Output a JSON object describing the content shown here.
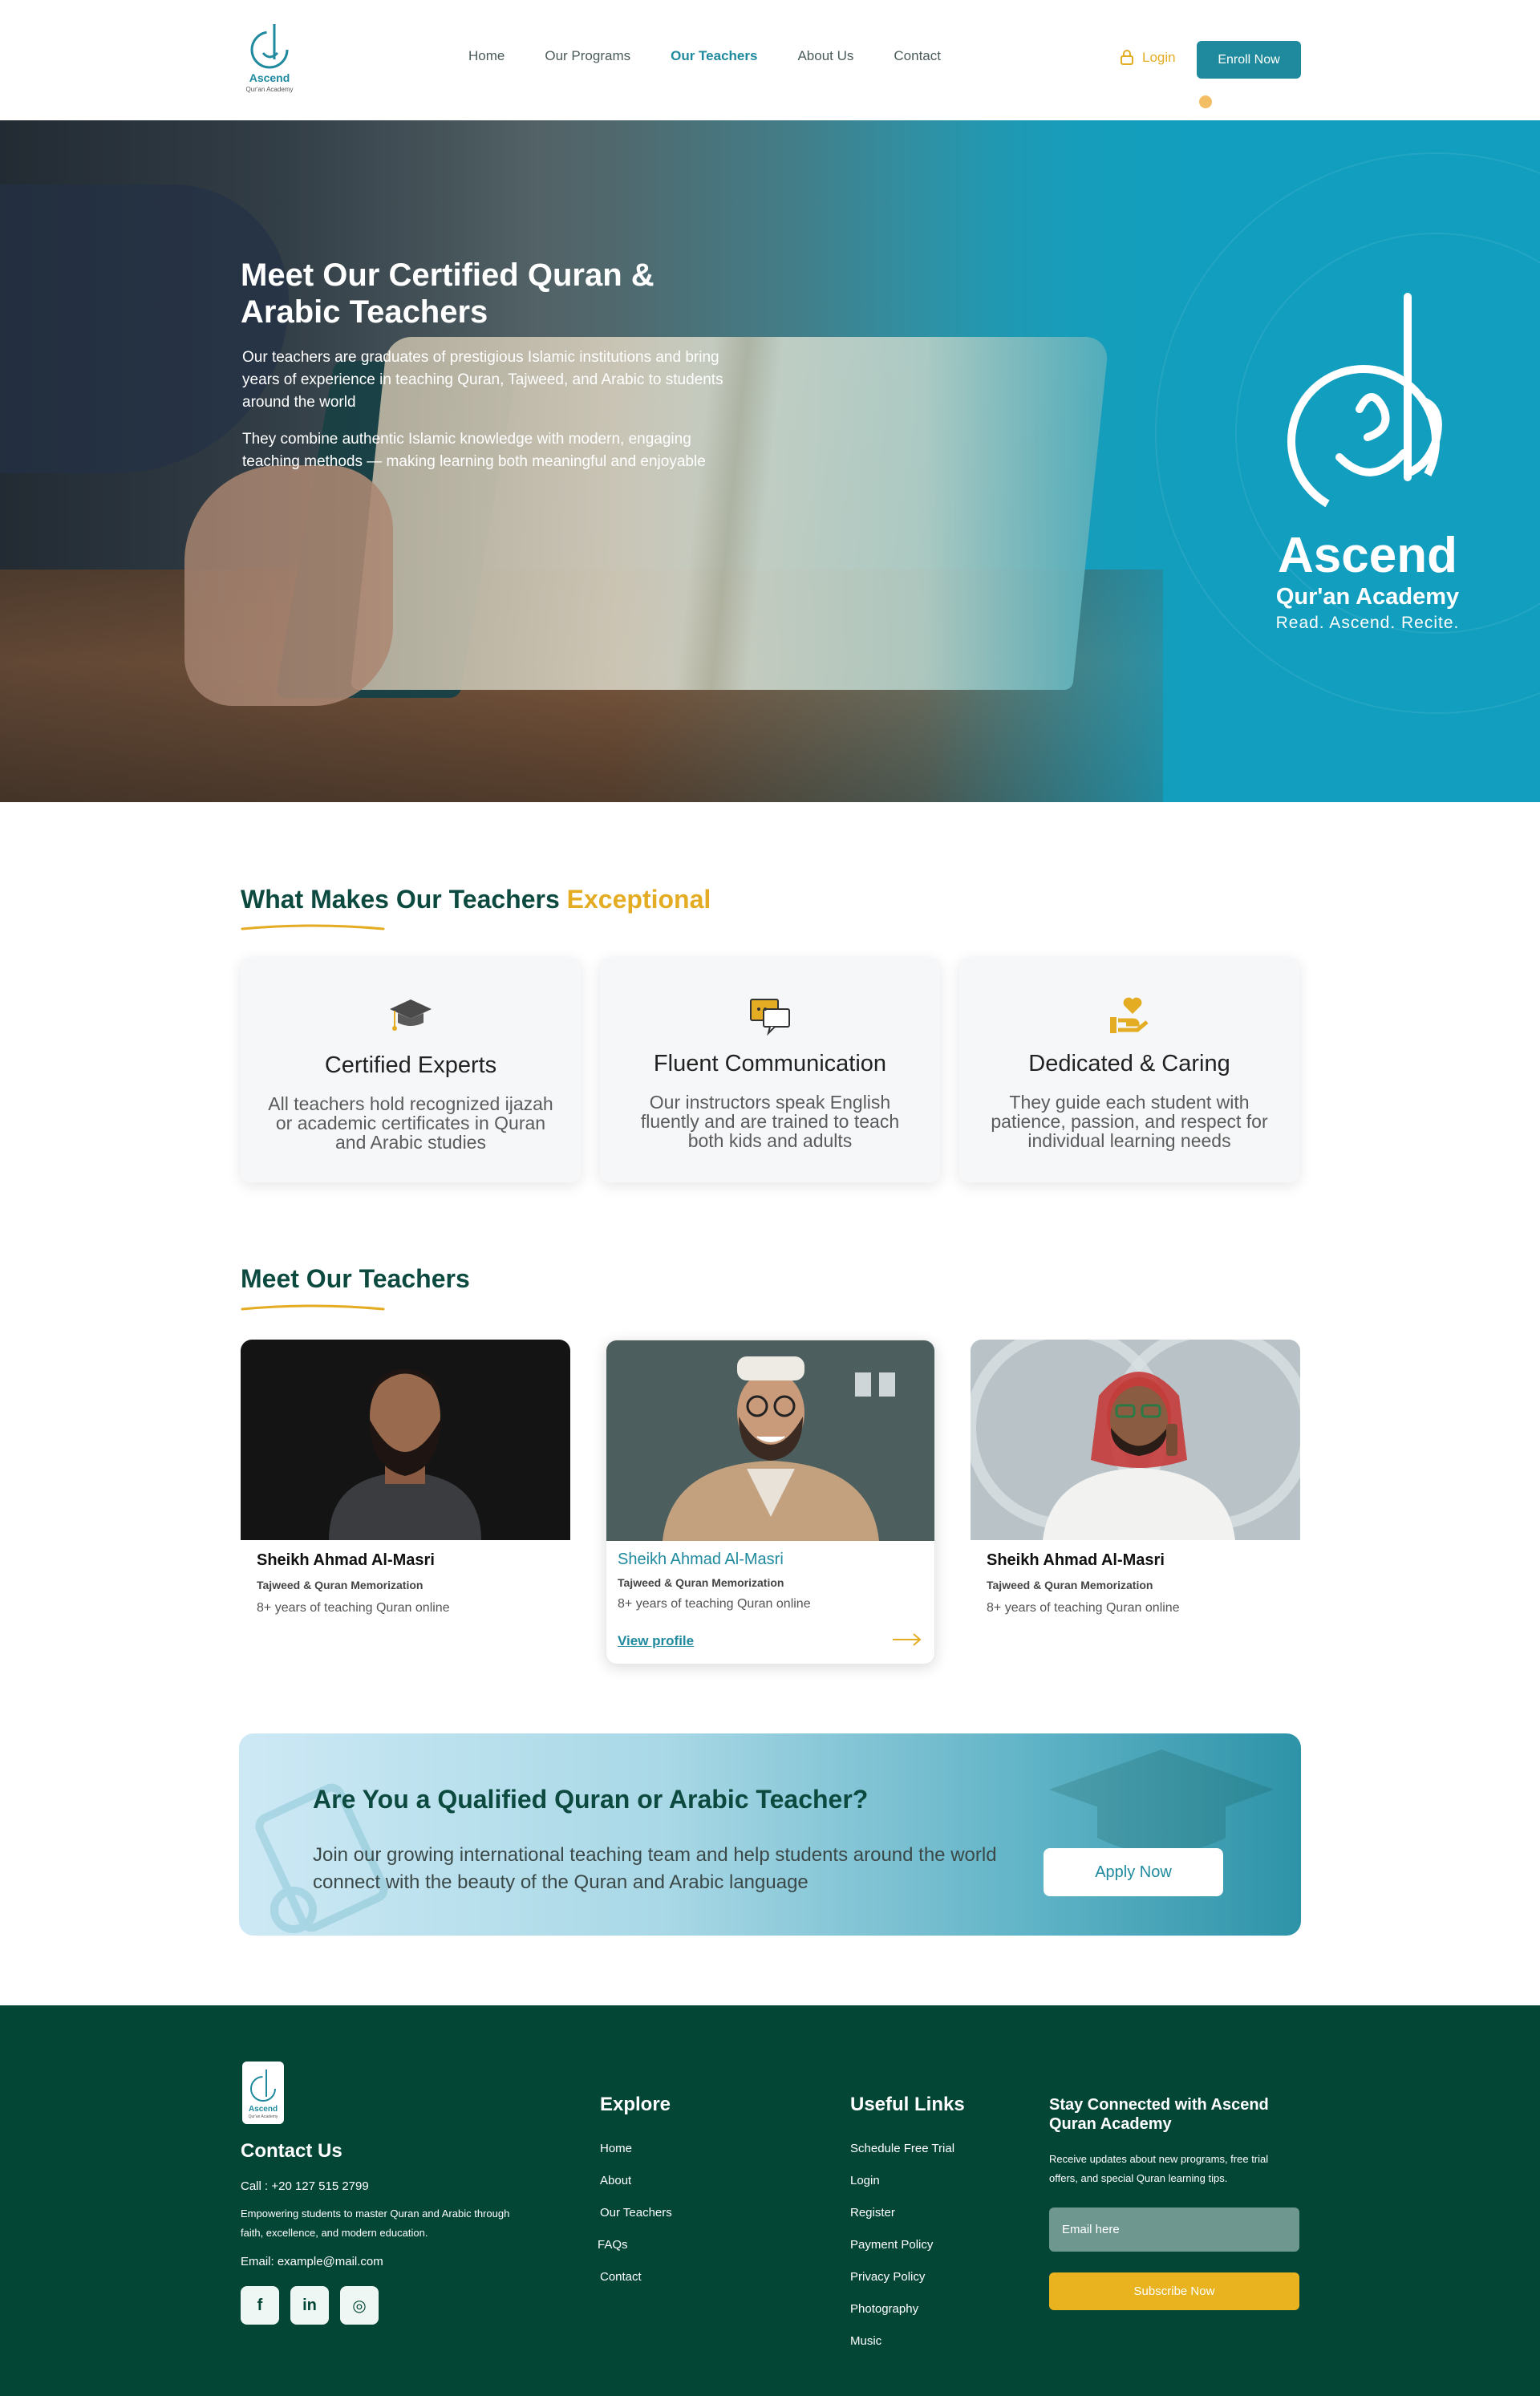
{
  "header": {
    "logo_name": "Ascend",
    "logo_sub": "Qur'an Academy",
    "nav": [
      {
        "label": "Home"
      },
      {
        "label": "Our Programs"
      },
      {
        "label": "Our Teachers"
      },
      {
        "label": "About Us"
      },
      {
        "label": "Contact"
      }
    ],
    "login_label": "Login",
    "enroll_label": "Enroll Now",
    "accent": "#1f8a9e",
    "gold": "#e3ac23"
  },
  "hero": {
    "title": "Meet Our Certified Quran & Arabic Teachers",
    "p1": "Our teachers are graduates of prestigious Islamic institutions and bring years of experience in teaching Quran, Tajweed, and Arabic to students around the world",
    "p2": "They combine authentic Islamic knowledge with modern, engaging teaching methods — making learning both meaningful and enjoyable",
    "brand_name": "Ascend",
    "brand_sub": "Qur'an Academy",
    "brand_tag": "Read. Ascend. Recite."
  },
  "features": {
    "title_main": "What Makes Our Teachers ",
    "title_accent": "Exceptional",
    "items": [
      {
        "icon": "graduation-cap-icon",
        "title": "Certified Experts",
        "text": "All teachers hold recognized ijazah or academic certificates in Quran and Arabic studies"
      },
      {
        "icon": "chat-bubbles-icon",
        "title": "Fluent Communication",
        "text": "Our instructors speak English fluently and are trained to teach both kids and adults"
      },
      {
        "icon": "heart-hand-icon",
        "title": "Dedicated & Caring",
        "text": "They guide each student with patience, passion, and respect for individual learning needs"
      }
    ]
  },
  "teachers": {
    "title": "Meet Our Teachers",
    "items": [
      {
        "name": "Sheikh Ahmad Al-Masri",
        "spec": "Tajweed & Quran Memorization",
        "exp": "8+ years of teaching Quran online"
      },
      {
        "name": "Sheikh Ahmad Al-Masri",
        "spec": "Tajweed & Quran Memorization",
        "exp": "8+ years of teaching Quran online",
        "link": "View profile"
      },
      {
        "name": "Sheikh Ahmad Al-Masri",
        "spec": "Tajweed & Quran Memorization",
        "exp": "8+ years of teaching Quran online"
      }
    ]
  },
  "cta": {
    "title": "Are You a Qualified Quran or Arabic Teacher?",
    "text": "Join our growing international teaching team and help students around the world connect with the beauty of the Quran and Arabic language",
    "button": "Apply Now"
  },
  "footer": {
    "contact_title": "Contact Us",
    "call": "Call :  +20 127 515 2799",
    "about": "Empowering students to master Quran and Arabic through faith, excellence, and modern education.",
    "email": "Email: example@mail.com",
    "social": [
      {
        "icon": "facebook-icon",
        "glyph": "f"
      },
      {
        "icon": "linkedin-icon",
        "glyph": "in"
      },
      {
        "icon": "instagram-icon",
        "glyph": "◎"
      }
    ],
    "explore_title": "Explore",
    "explore": [
      "Home",
      "About",
      "Our Teachers",
      "FAQs",
      "Contact"
    ],
    "useful_title": "Useful Links",
    "useful": [
      "Schedule Free Trial",
      "Login",
      "Register",
      "Payment Policy",
      "Privacy Policy",
      "Photography",
      "Music"
    ],
    "stay_title": "Stay Connected with Ascend Quran Academy",
    "stay_text": "Receive updates about new programs, free trial offers, and special Quran learning tips.",
    "email_placeholder": "Email here",
    "subscribe": "Subscribe Now",
    "bg": "#044636"
  }
}
